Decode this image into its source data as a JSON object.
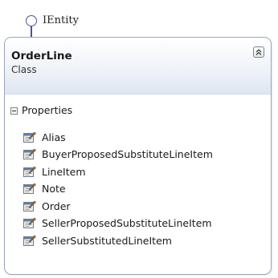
{
  "interface": {
    "name": "IEntity",
    "icon": "lollipop-interface-icon"
  },
  "class_shape": {
    "name": "OrderLine",
    "stereotype": "Class",
    "collapse_icon": "double-chevron-up-icon"
  },
  "properties": {
    "title": "Properties",
    "toggle_icon": "minus-box-icon",
    "item_icon": "property-wrench-icon",
    "items": [
      "Alias",
      "BuyerProposedSubstituteLineItem",
      "LineItem",
      "Note",
      "Order",
      "SellerProposedSubstituteLineItem",
      "SellerSubstitutedLineItem"
    ]
  },
  "colors": {
    "connector": "#4a4fa8",
    "border": "#9aa4b8",
    "header_gradient_end": "#dfe6f1"
  }
}
